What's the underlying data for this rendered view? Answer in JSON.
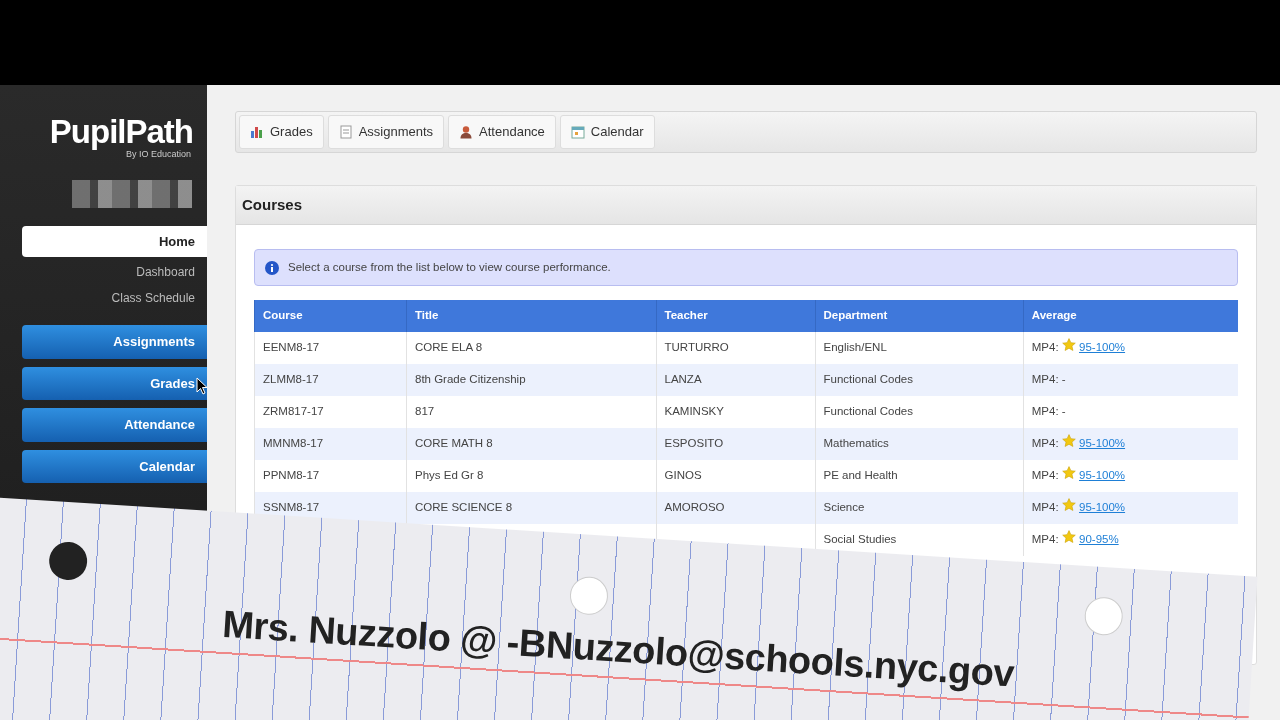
{
  "logo": {
    "title": "PupilPath",
    "subtitle": "By IO Education"
  },
  "sidebar": {
    "items": [
      {
        "label": "Home",
        "kind": "tab",
        "selected": true
      },
      {
        "label": "Dashboard",
        "kind": "sublink",
        "selected": false
      },
      {
        "label": "Class Schedule",
        "kind": "sublink",
        "selected": false
      },
      {
        "label": "Assignments",
        "kind": "button",
        "selected": false
      },
      {
        "label": "Grades",
        "kind": "button",
        "selected": false
      },
      {
        "label": "Attendance",
        "kind": "button",
        "selected": false
      },
      {
        "label": "Calendar",
        "kind": "button",
        "selected": false
      }
    ]
  },
  "toolbar": [
    {
      "label": "Grades",
      "kind": "chart"
    },
    {
      "label": "Assignments",
      "kind": "document"
    },
    {
      "label": "Attendance",
      "kind": "person"
    },
    {
      "label": "Calendar",
      "kind": "calendar"
    }
  ],
  "panel": {
    "title": "Courses",
    "alert": "Select a course from the list below to view course performance.",
    "table": {
      "columns": [
        "Course",
        "Title",
        "Teacher",
        "Department",
        "Average"
      ],
      "rows": [
        {
          "course": "EENM8-17",
          "title": "CORE ELA 8",
          "teacher": "TURTURRO",
          "department": "English/ENL",
          "average": {
            "label": "MP4:",
            "grade": "95-100%",
            "star": true
          }
        },
        {
          "course": "ZLMM8-17",
          "title": "8th Grade Citizenship",
          "teacher": "LANZA",
          "department": "Functional Codes",
          "average": {
            "label": "MP4:",
            "grade": "-",
            "star": false
          }
        },
        {
          "course": "ZRM817-17",
          "title": "817",
          "teacher": "KAMINSKY",
          "department": "Functional Codes",
          "average": {
            "label": "MP4:",
            "grade": "-",
            "star": false
          }
        },
        {
          "course": "MMNM8-17",
          "title": "CORE MATH 8",
          "teacher": "ESPOSITO",
          "department": "Mathematics",
          "average": {
            "label": "MP4:",
            "grade": "95-100%",
            "star": true
          }
        },
        {
          "course": "PPNM8-17",
          "title": "Phys Ed Gr 8",
          "teacher": "GINOS",
          "department": "PE and Health",
          "average": {
            "label": "MP4:",
            "grade": "95-100%",
            "star": true
          }
        },
        {
          "course": "SSNM8-17",
          "title": "CORE SCIENCE 8",
          "teacher": "AMOROSO",
          "department": "Science",
          "average": {
            "label": "MP4:",
            "grade": "95-100%",
            "star": true
          }
        },
        {
          "department": "Social Studies",
          "average": {
            "label": "MP4:",
            "grade": "90-95%",
            "star": true
          }
        }
      ]
    }
  },
  "banner": {
    "text": "Mrs. Nuzzolo @ -BNuzzolo@schools.nyc.gov"
  }
}
